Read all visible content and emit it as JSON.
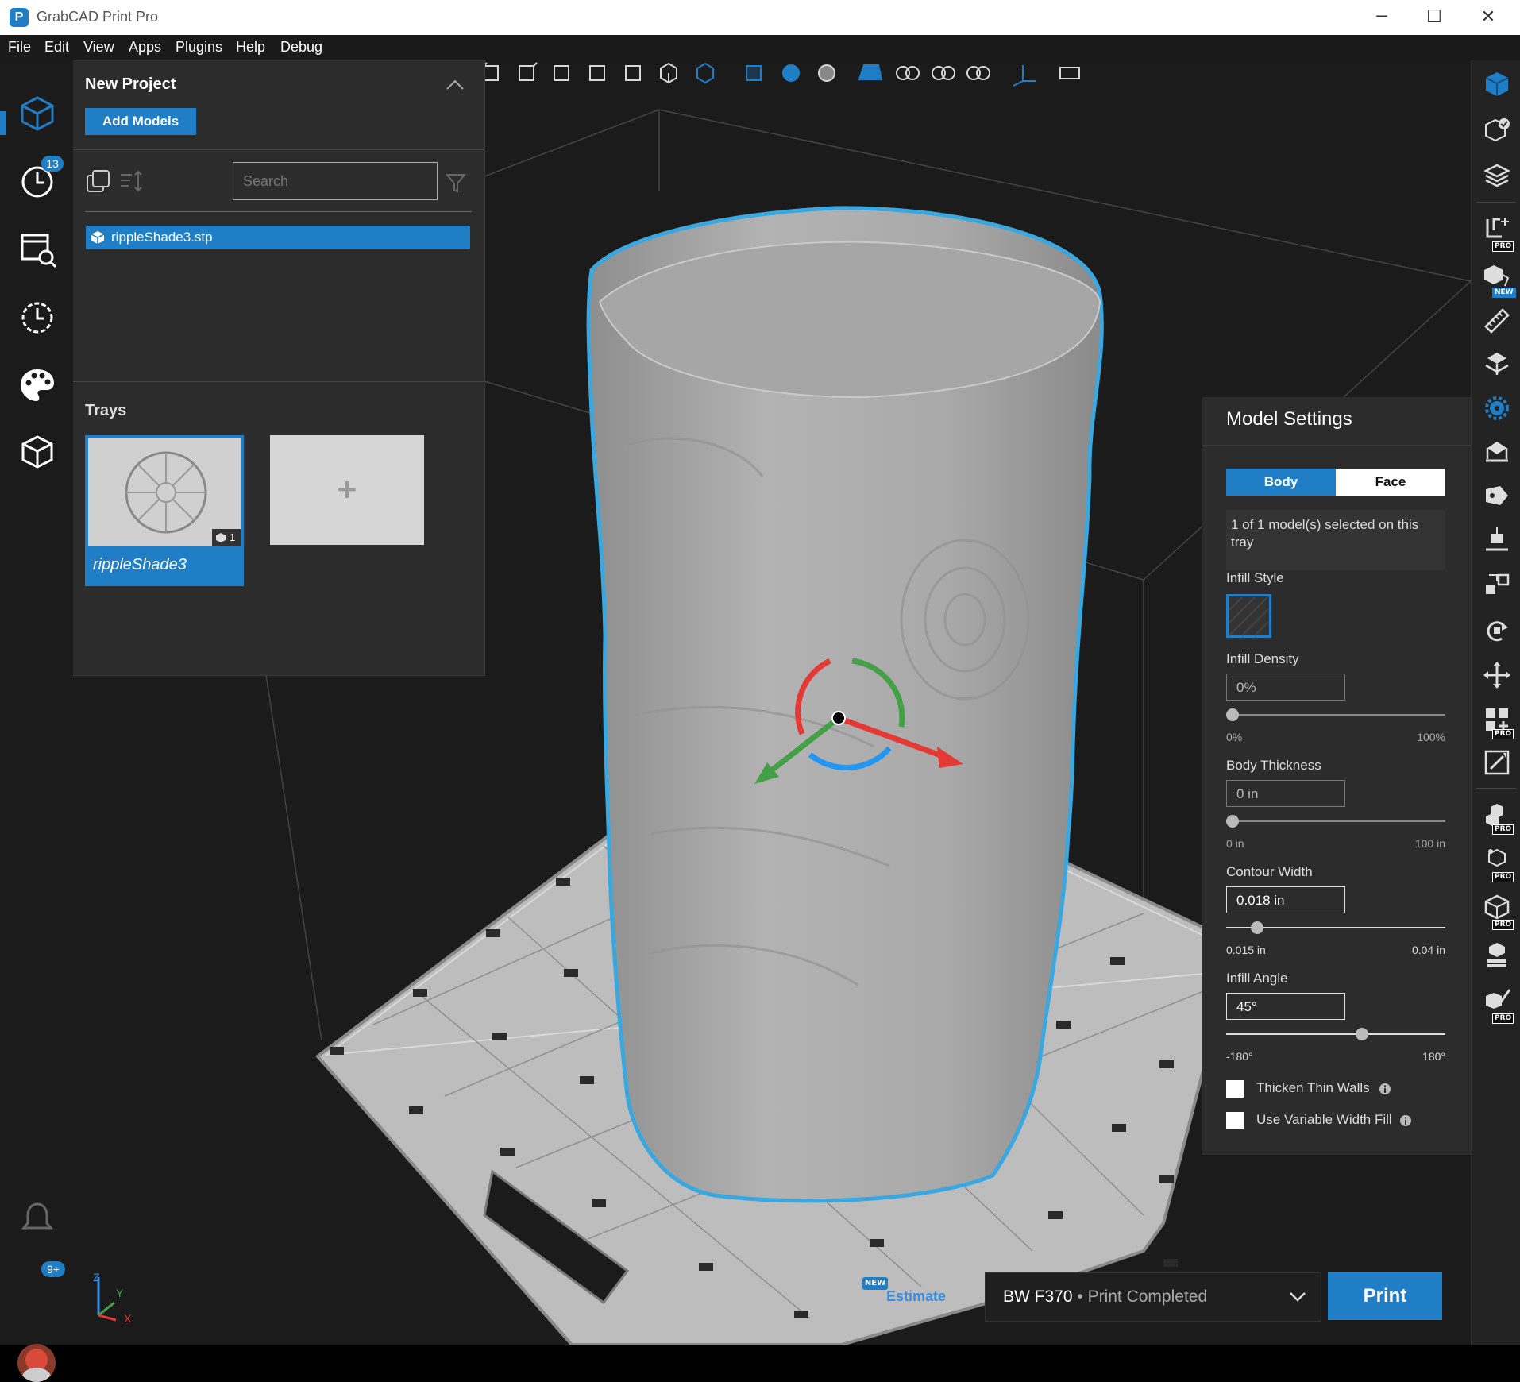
{
  "app": {
    "title": "GrabCAD Print Pro"
  },
  "window": {
    "minimize": "─",
    "maximize": "☐",
    "close": "✕"
  },
  "menu": [
    "File",
    "Edit",
    "View",
    "Apps",
    "Plugins",
    "Help",
    "Debug"
  ],
  "left_rail": {
    "history_badge": "13",
    "notification_badge": "9+"
  },
  "project": {
    "title": "New Project",
    "add_models": "Add Models",
    "search_placeholder": "Search",
    "model_item": "rippleShade3.stp",
    "trays_label": "Trays",
    "tray_name": "rippleShade3",
    "tray_count": "1",
    "add_tray": "+"
  },
  "settings": {
    "title": "Model Settings",
    "tab_body": "Body",
    "tab_face": "Face",
    "selection_info": "1 of 1 model(s) selected on this tray",
    "infill_style_label": "Infill Style",
    "infill_density_label": "Infill Density",
    "infill_density_value": "0%",
    "infill_density_min": "0%",
    "infill_density_max": "100%",
    "infill_density_level": 0,
    "body_thickness_label": "Body Thickness",
    "body_thickness_value": "0 in",
    "body_thickness_min": "0 in",
    "body_thickness_max": "100 in",
    "body_thickness_level": 0,
    "contour_width_label": "Contour Width",
    "contour_width_value": "0.018 in",
    "contour_width_min": "0.015 in",
    "contour_width_max": "0.04 in",
    "contour_width_level": 0.12,
    "infill_angle_label": "Infill Angle",
    "infill_angle_value": "45°",
    "infill_angle_min": "-180°",
    "infill_angle_max": "180°",
    "infill_angle_level": 0.625,
    "thicken_thin_walls": "Thicken Thin Walls",
    "variable_width_fill": "Use Variable Width Fill"
  },
  "bottom": {
    "estimate_badge": "NEW",
    "estimate": "Estimate",
    "printer": "BW F370",
    "printer_sep": " • ",
    "printer_status": "Print Completed",
    "print_button": "Print"
  },
  "right_rail": {
    "pro_badge": "PRO",
    "new_badge": "NEW"
  },
  "axes": {
    "z": "Z",
    "y": "Y",
    "x": "X"
  },
  "colors": {
    "accent": "#1f7ec6",
    "selection_outline": "#3aa8e0",
    "panel": "#2c2c2c"
  }
}
